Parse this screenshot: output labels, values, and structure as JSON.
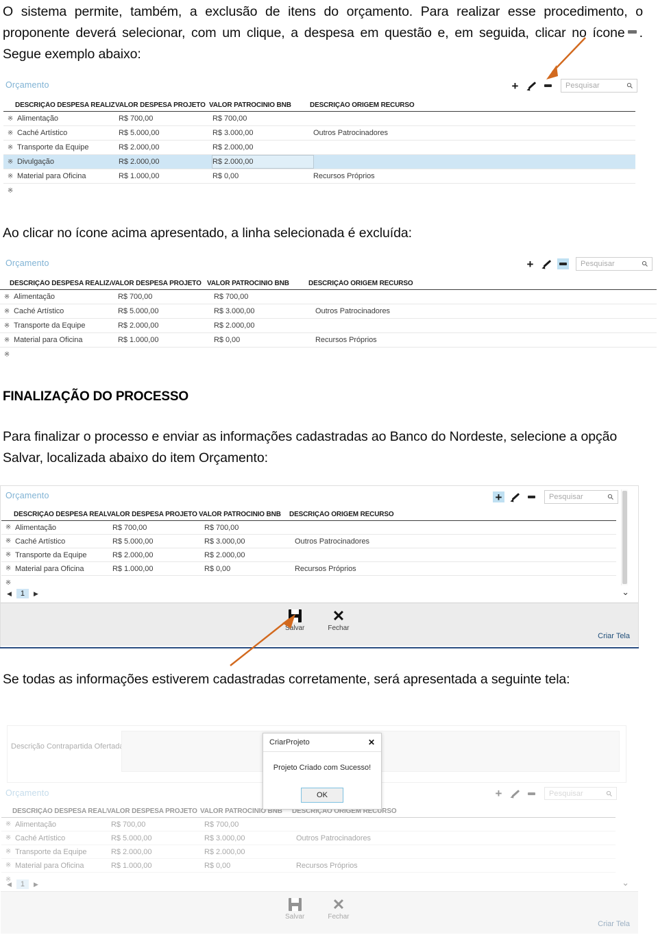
{
  "paragraphs": {
    "p1_before": "O sistema permite, também, a exclusão de itens do orçamento. Para realizar esse procedimento, o proponente deverá selecionar, com um clique, a despesa em questão e, em seguida, clicar no ícone",
    "p1_after": ". Segue exemplo abaixo:",
    "p2": "Ao clicar no ícone acima apresentado, a linha selecionada é excluída:",
    "heading": "FINALIZAÇÃO DO PROCESSO",
    "p3": "Para finalizar o processo e enviar as informações cadastradas ao Banco do Nordeste, selecione a opção Salvar, localizada abaixo do item Orçamento:",
    "p4": "Se todas as informações estiverem cadastradas corretamente, será apresentada a seguinte tela:"
  },
  "screens": {
    "section_title": "Orçamento",
    "toolbar": {
      "add_label": "+",
      "edit_label": "edit",
      "remove_label": "-",
      "search_placeholder": "Pesquisar",
      "search_value": ""
    },
    "columns": [
      "DESCRIÇÃO DESPESA REALIZA",
      "VALOR DESPESA PROJETO",
      "VALOR PATROCÍNIO BNB",
      "DESCRIÇÃO ORIGEM RECURSO"
    ],
    "rows_before": [
      {
        "descricao": "Alimentação",
        "valor_despesa": "R$ 700,00",
        "valor_patrocinio": "R$ 700,00",
        "origem": "",
        "selected": false
      },
      {
        "descricao": "Caché Artístico",
        "valor_despesa": "R$ 5.000,00",
        "valor_patrocinio": "R$ 3.000,00",
        "origem": "Outros Patrocinadores",
        "selected": false
      },
      {
        "descricao": "Transporte da Equipe",
        "valor_despesa": "R$ 2.000,00",
        "valor_patrocinio": "R$ 2.000,00",
        "origem": "",
        "selected": false
      },
      {
        "descricao": "Divulgação",
        "valor_despesa": "R$ 2.000,00",
        "valor_patrocinio": "R$ 2.000,00",
        "origem": "",
        "selected": true
      },
      {
        "descricao": "Material para Oficina",
        "valor_despesa": "R$ 1.000,00",
        "valor_patrocinio": "R$ 0,00",
        "origem": "Recursos Próprios",
        "selected": false
      }
    ],
    "rows_after": [
      {
        "descricao": "Alimentação",
        "valor_despesa": "R$ 700,00",
        "valor_patrocinio": "R$ 700,00",
        "origem": "",
        "selected": false
      },
      {
        "descricao": "Caché Artístico",
        "valor_despesa": "R$ 5.000,00",
        "valor_patrocinio": "R$ 3.000,00",
        "origem": "Outros Patrocinadores",
        "selected": false
      },
      {
        "descricao": "Transporte da Equipe",
        "valor_despesa": "R$ 2.000,00",
        "valor_patrocinio": "R$ 2.000,00",
        "origem": "",
        "selected": false
      },
      {
        "descricao": "Material para Oficina",
        "valor_despesa": "R$ 1.000,00",
        "valor_patrocinio": "R$ 0,00",
        "origem": "Recursos Próprios",
        "selected": false
      }
    ],
    "pager": {
      "prev": "◀",
      "page": "1",
      "next": "▶"
    },
    "footer": {
      "save_label": "Salvar",
      "close_label": "Fechar",
      "criar_tela": "Criar Tela"
    },
    "form": {
      "contrapartida_label": "Descrição Contrapartida Ofertada:",
      "contrapartida_value": ""
    }
  },
  "modal": {
    "title": "CriarProjeto",
    "close": "✕",
    "message": "Projeto Criado com Sucesso!",
    "ok_label": "OK"
  },
  "colors": {
    "accent_blue": "#7fb2d4",
    "highlight": "#cfe6f5",
    "arrow_orange": "#d2691e",
    "link_blue": "#1f4e79"
  }
}
